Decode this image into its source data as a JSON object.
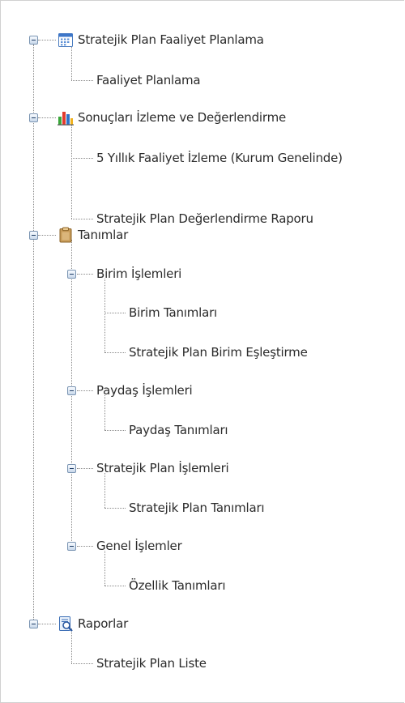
{
  "tree": {
    "planning": {
      "label": "Stratejik Plan Faaliyet Planlama",
      "children": [
        "Faaliyet Planlama"
      ]
    },
    "monitoring": {
      "label": "Sonuçları İzleme ve Değerlendirme",
      "children": [
        "5 Yıllık Faaliyet İzleme (Kurum Genelinde)",
        "Stratejik Plan Değerlendirme Raporu"
      ]
    },
    "definitions": {
      "label": "Tanımlar",
      "groups": [
        {
          "label": "Birim İşlemleri",
          "children": [
            "Birim Tanımları",
            "Stratejik Plan Birim Eşleştirme"
          ]
        },
        {
          "label": "Paydaş İşlemleri",
          "children": [
            "Paydaş Tanımları"
          ]
        },
        {
          "label": "Stratejik Plan İşlemleri",
          "children": [
            "Stratejik Plan Tanımları"
          ]
        },
        {
          "label": "Genel İşlemler",
          "children": [
            "Özellik Tanımları"
          ]
        }
      ]
    },
    "reports": {
      "label": "Raporlar",
      "children": [
        "Stratejik Plan Liste"
      ]
    }
  },
  "icons": {
    "planning": "calendar-icon",
    "monitoring": "bar-chart-icon",
    "definitions": "clipboard-icon",
    "reports": "report-magnifier-icon"
  }
}
